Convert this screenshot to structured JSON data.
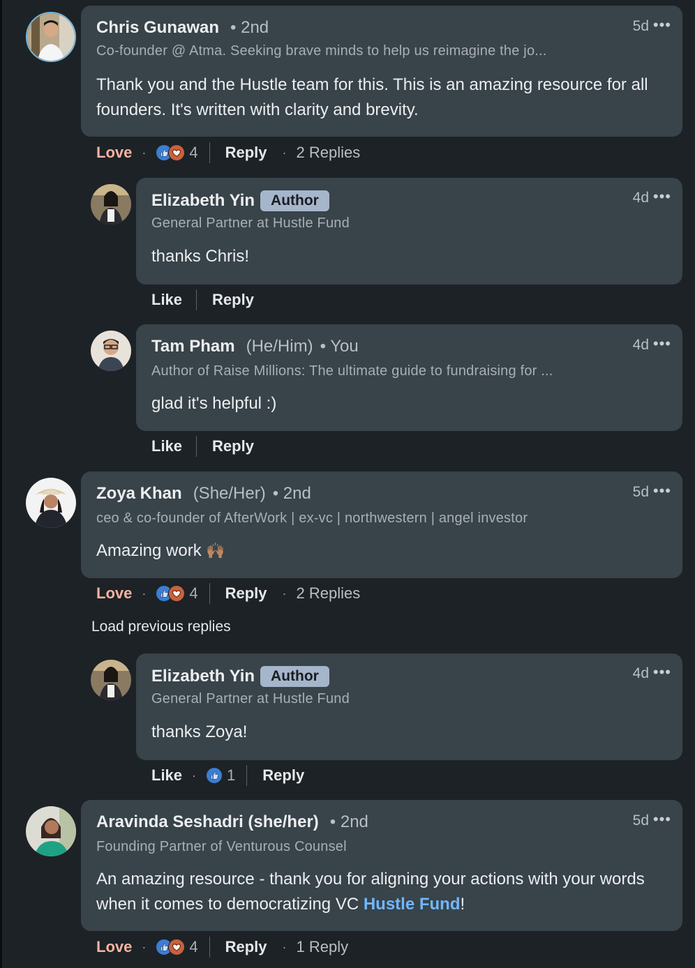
{
  "comments": [
    {
      "name": "Chris Gunawan",
      "pronouns": "",
      "degree": "• 2nd",
      "headline": "Co-founder @ Atma. Seeking brave minds to help us reimagine the jo...",
      "time": "5d",
      "text": "Thank you and the Hustle team for this. This is an amazing resource for all founders. It's written with clarity and brevity.",
      "reaction_label": "Love",
      "reaction_count": "4",
      "reply_label": "Reply",
      "replies_label": "2 Replies"
    },
    {
      "name": "Elizabeth Yin",
      "badge": "Author",
      "headline": "General Partner at Hustle Fund",
      "time": "4d",
      "text": "thanks Chris!",
      "like_label": "Like",
      "reply_label": "Reply"
    },
    {
      "name": "Tam Pham",
      "pronouns": "(He/Him)",
      "degree": "• You",
      "headline": "Author of Raise Millions: The ultimate guide to fundraising for ...",
      "time": "4d",
      "text": "glad it's helpful :)",
      "like_label": "Like",
      "reply_label": "Reply"
    },
    {
      "name": "Zoya Khan",
      "pronouns": "(She/Her)",
      "degree": "• 2nd",
      "headline": "ceo & co-founder of AfterWork | ex-vc | northwestern | angel investor",
      "time": "5d",
      "text": "Amazing work",
      "emoji": "🙌🏽",
      "reaction_label": "Love",
      "reaction_count": "4",
      "reply_label": "Reply",
      "replies_label": "2 Replies"
    },
    {
      "name": "Elizabeth Yin",
      "badge": "Author",
      "headline": "General Partner at Hustle Fund",
      "time": "4d",
      "text": "thanks Zoya!",
      "like_label": "Like",
      "reaction_count": "1",
      "reply_label": "Reply"
    },
    {
      "name": "Aravinda Seshadri (she/her)",
      "pronouns": "",
      "degree": "• 2nd",
      "headline": "Founding Partner of Venturous Counsel",
      "time": "5d",
      "text": "An amazing resource - thank you for aligning your actions with your words when it comes to democratizing VC ",
      "mention": "Hustle Fund",
      "text_end": "!",
      "reaction_label": "Love",
      "reaction_count": "4",
      "reply_label": "Reply",
      "replies_label": "1 Reply"
    }
  ],
  "load_previous_label": "Load previous replies",
  "more_icon": "•••",
  "colors": {
    "background": "#1d2226",
    "card": "#38434a",
    "love": "#f5b4a1",
    "link": "#71b7fb",
    "badge": "#a5b6cb"
  }
}
